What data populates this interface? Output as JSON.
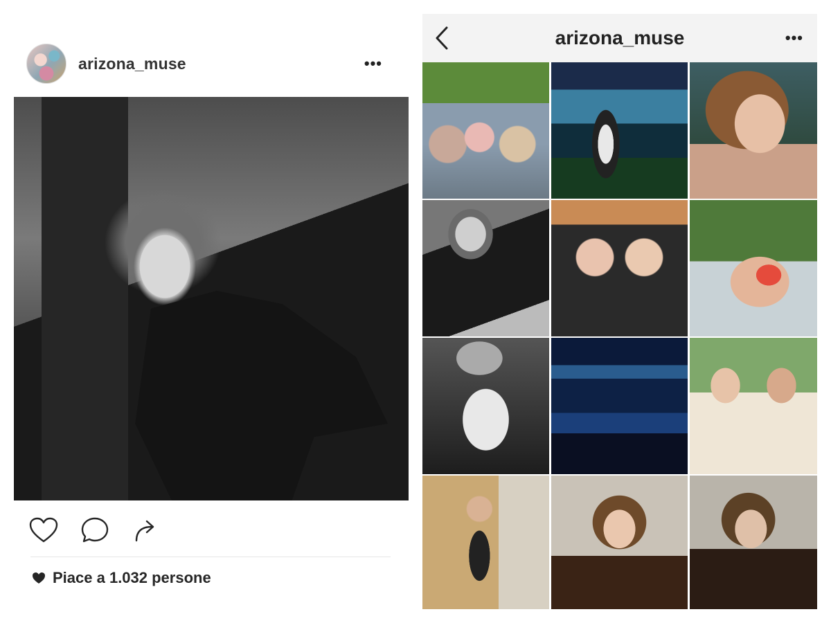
{
  "post": {
    "username": "arizona_muse",
    "more_label": "•••",
    "photo_description": "",
    "likes_text": "Piace a 1.032 persone"
  },
  "profile": {
    "title": "arizona_muse",
    "more_label": "•••"
  },
  "icons": {
    "like": "heart-icon",
    "comment": "comment-icon",
    "share": "share-icon",
    "back": "back-chevron-icon",
    "more": "more-icon"
  },
  "colors": {
    "text": "#262626",
    "bar_background": "#f3f3f3",
    "divider": "#e6e6e6"
  }
}
